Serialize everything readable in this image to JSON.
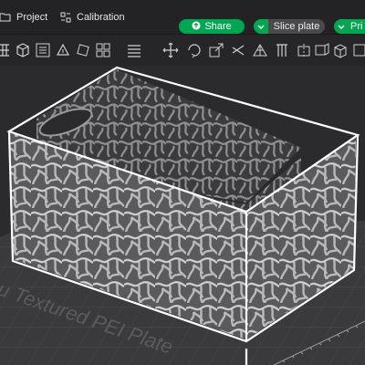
{
  "header": {
    "tabs": [
      {
        "label": "Project",
        "icon": "folder-icon"
      },
      {
        "label": "Calibration",
        "icon": "calibration-icon"
      }
    ],
    "share_label": "Share",
    "slice_label": "Slice plate",
    "print_label": "Pri"
  },
  "toolbar": {
    "tools": [
      "grid-icon",
      "cube-add-icon",
      "list-icon",
      "orient-icon",
      "rotate-icon",
      "arrange-icon",
      "list-view-icon",
      "move-icon",
      "rotate-3d-icon",
      "scale-icon",
      "cut-icon",
      "mesh-icon",
      "support-icon",
      "seam-icon",
      "text-icon",
      "measure-icon",
      "assembly-icon",
      "view-cube-icon",
      "split-icon"
    ]
  },
  "viewport": {
    "plate_label": "u Textured PEI Plate",
    "object": "voronoi-basket"
  },
  "colors": {
    "accent": "#00a651",
    "topbar": "#232325",
    "plate": "#3a3a3d"
  }
}
